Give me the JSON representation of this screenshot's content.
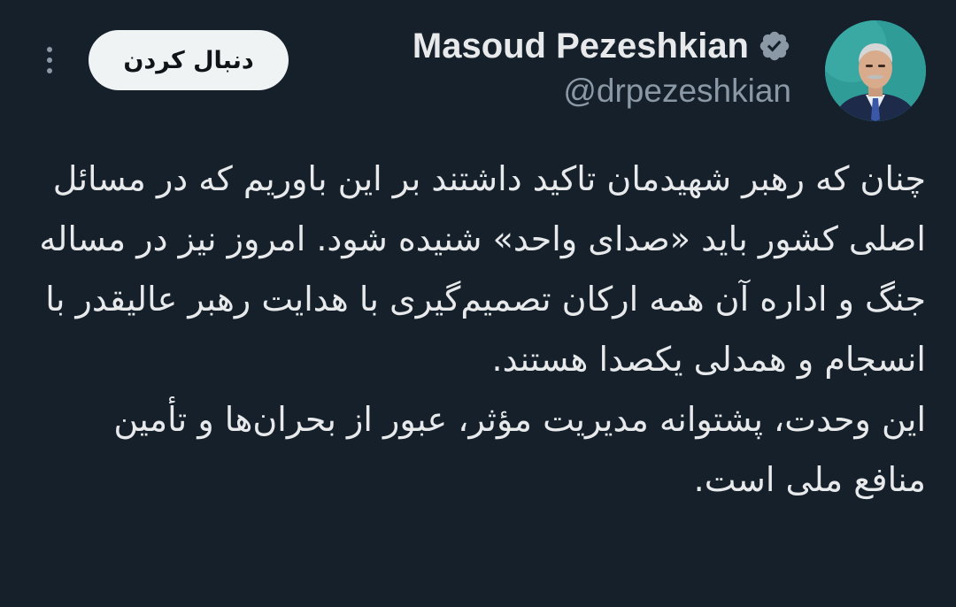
{
  "header": {
    "display_name": "Masoud Pezeshkian",
    "handle": "@drpezeshkian",
    "follow_label": "دنبال کردن",
    "more_icon": "more-vertical-icon",
    "verified_icon": "verified-badge-icon"
  },
  "tweet": {
    "text": "چنان که رهبر شهیدمان تاکید داشتند بر این باوریم که در مسائل اصلی کشور باید «صدای واحد» شنیده شود. امروز نیز در مساله جنگ و اداره آن همه ارکان تصمیم‌گیری با هدایت رهبر عالیقدر با انسجام و همدلی یکصدا هستند.\nاین وحدت، پشتوانه مدیریت مؤثر، عبور از بحران‌ها و تأمین منافع ملی است."
  },
  "colors": {
    "background": "#15202b",
    "text_primary": "#e7e9ea",
    "text_secondary": "#8b98a5",
    "follow_bg": "#eff3f4",
    "verified_badge": "#8b98a5"
  }
}
